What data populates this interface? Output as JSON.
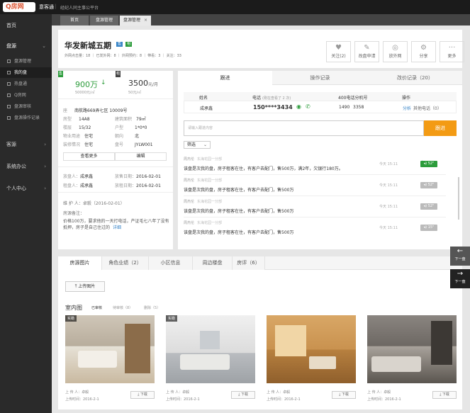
{
  "topbar": {
    "logo": "Q房网",
    "app_name": "意客通",
    "divider": "|",
    "slogan": "经纪人同主事公平台"
  },
  "sidebar": {
    "items": [
      {
        "label": "首页"
      },
      {
        "label": "盘源"
      },
      {
        "label": "客源"
      },
      {
        "label": "系统办公"
      },
      {
        "label": "个人中心"
      }
    ],
    "sub_items": [
      {
        "label": "盘源管理"
      },
      {
        "label": "我的盘"
      },
      {
        "label": "热盘通"
      },
      {
        "label": "Q房网"
      },
      {
        "label": "盘源审核"
      },
      {
        "label": "盘源操作记录"
      }
    ]
  },
  "tabs": [
    {
      "label": "首页"
    },
    {
      "label": "盘源管理"
    },
    {
      "label": "盘源管理"
    }
  ],
  "tab_close": "×",
  "header": {
    "title": "华发新城五期",
    "tag_sell": "售",
    "tag_rent": "租",
    "stats": "外网点击量：18 ｜ 已发外网：8 ｜ 外网预约：8 ｜ 带看：3 ｜ 关注：33",
    "actions": [
      {
        "label": "关注(2)",
        "icon": "heart-icon"
      },
      {
        "label": "改盘申请",
        "icon": "edit-icon"
      },
      {
        "label": "放外网",
        "icon": "publish-icon"
      },
      {
        "label": "分享",
        "icon": "share-icon"
      },
      {
        "label": "更多",
        "icon": "more-icon"
      }
    ]
  },
  "price": {
    "sell_badge": "售",
    "sell_price": "900万",
    "sell_unit_price": "50000元/㎡",
    "rent_badge": "租",
    "rent_price": "3500",
    "rent_unit": "元/月",
    "rent_unit_price": "50元/㎡"
  },
  "info": {
    "address_label": "座",
    "address": "南航路669弄七区 10009号",
    "area_label": "房型",
    "area": "14A8",
    "build_area_label": "建筑面积",
    "build_area": "79㎡",
    "floor_label": "楼层",
    "floor": "15/32",
    "layout_label": "户型",
    "layout": "1*0*0",
    "use_label": "物业用途",
    "use": "住宅",
    "orient_label": "朝向",
    "orient": "北",
    "deco_label": "装修情况",
    "deco": "住宅",
    "code_label": "盘号",
    "code": "JYLW001",
    "view_more": "查看更多",
    "edit": "编辑"
  },
  "owners": {
    "seller_label": "放盘人：",
    "seller": "成承鑫",
    "sell_date_label": "放售日期：",
    "sell_date": "2016-02-01",
    "renter_label": "租盘人：",
    "renter": "成承鑫",
    "rent_date_label": "放租日期：",
    "rent_date": "2016-02-01",
    "maint": "维 护 人：卓毅（2016-02-01）",
    "remark_label": "房源备注：",
    "remark": "价格100万，要求他的一天打电话，产证毛七八年了没有抵押，房子是自己住过的",
    "remark_more": "详细"
  },
  "track": {
    "tabs": [
      {
        "label": "跟进"
      },
      {
        "label": "操作记录"
      },
      {
        "label": "改价记录（20）"
      }
    ],
    "contact_headers": {
      "name": "姓名",
      "phone": "电话",
      "phone_note": "(刚在查看了 2 次)",
      "phone400": "400电话分机号",
      "action": "操作"
    },
    "contact": {
      "name": "成承鑫",
      "phone": "150****3434",
      "ext1": "1490",
      "ext2": "3358",
      "link1": "分析",
      "link2": "其他电话（0）"
    },
    "input_placeholder": "请输入跟进内容",
    "submit": "跟进",
    "filter": "筛选",
    "entries": [
      {
        "who": "周杰伦",
        "place": "东海花园一分部",
        "text": "该盘是次我的盘，房子租客在住，有客户去配门，售500万，满2年，欠银行180万。",
        "time": "今天 15:11",
        "dur": "52\"",
        "active": true
      },
      {
        "who": "周杰伦",
        "place": "东海花园一分部",
        "text": "该盘是次我的盘，房子租客在住，有客户去配门，售500万",
        "time": "今天 15:11",
        "dur": "52\"",
        "active": false
      },
      {
        "who": "周杰伦",
        "place": "东海花园一分部",
        "text": "该盘是次我的盘，房子租客在住，有客户去配门，售500万",
        "time": "今天 15:11",
        "dur": "52\"",
        "active": false
      },
      {
        "who": "周杰伦",
        "place": "东海花园一分部",
        "text": "该盘是次我的盘，房子租客在住，有客户去配门，售500万",
        "time": "今天 15:11",
        "dur": "15\"",
        "active": false
      }
    ]
  },
  "bottom": {
    "tabs": [
      {
        "label": "房源图片"
      },
      {
        "label": "角色业绩（2）"
      },
      {
        "label": "小区信息"
      },
      {
        "label": "周边楼盘"
      },
      {
        "label": "房评（6）"
      }
    ],
    "upload": "上传图片",
    "section": "室内图",
    "filters": {
      "approved": "已审核",
      "pending": "待审核（8）",
      "deleted": "删除（5）"
    },
    "photos": [
      {
        "badge": "实勘",
        "uploader": "上 传 人：卓毅",
        "time": "上传时间：2016-2-1",
        "download": "下载"
      },
      {
        "badge": "实勘",
        "uploader": "上 传 人：卓毅",
        "time": "上传时间：2016-2-1",
        "download": "下载"
      },
      {
        "badge": "",
        "uploader": "上 传 人：卓毅",
        "time": "上传时间：2016-2-1",
        "download": "下载"
      },
      {
        "badge": "",
        "uploader": "上 传 人：卓毅",
        "time": "上传时间：2016-2-1",
        "download": "下载"
      }
    ]
  },
  "pager": {
    "prev": "下一盘",
    "next": "下一盘"
  },
  "colors": {
    "accent": "#f39b14",
    "green": "#2c9c3b",
    "sidebar": "#2a2a2a"
  }
}
